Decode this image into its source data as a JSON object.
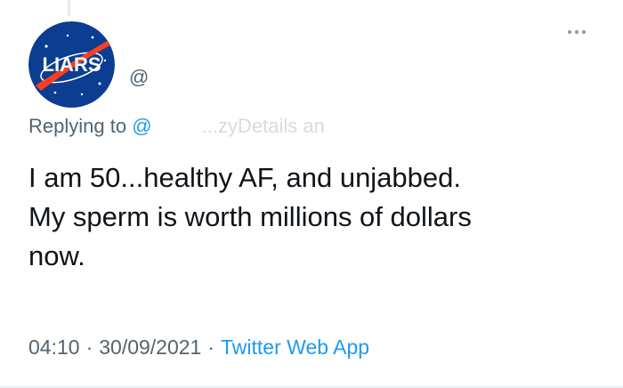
{
  "tweet": {
    "avatar_text": "LIARS",
    "handle": "@",
    "more_icon": "ellipsis-icon",
    "reply": {
      "prefix": "Replying to",
      "mention": "@",
      "obscured_tail": "...zyDetails an"
    },
    "text": "I am 50...healthy AF, and unjabbed.\nMy sperm is worth millions of dollars\nnow.",
    "time": "04:10",
    "separator": "·",
    "date": "30/09/2021",
    "source": "Twitter Web App"
  },
  "colors": {
    "text_primary": "#0f1419",
    "text_secondary": "#536471",
    "accent_blue": "#1d9bf0",
    "avatar_blue": "#0b3d91",
    "avatar_red": "#fc3d21"
  }
}
